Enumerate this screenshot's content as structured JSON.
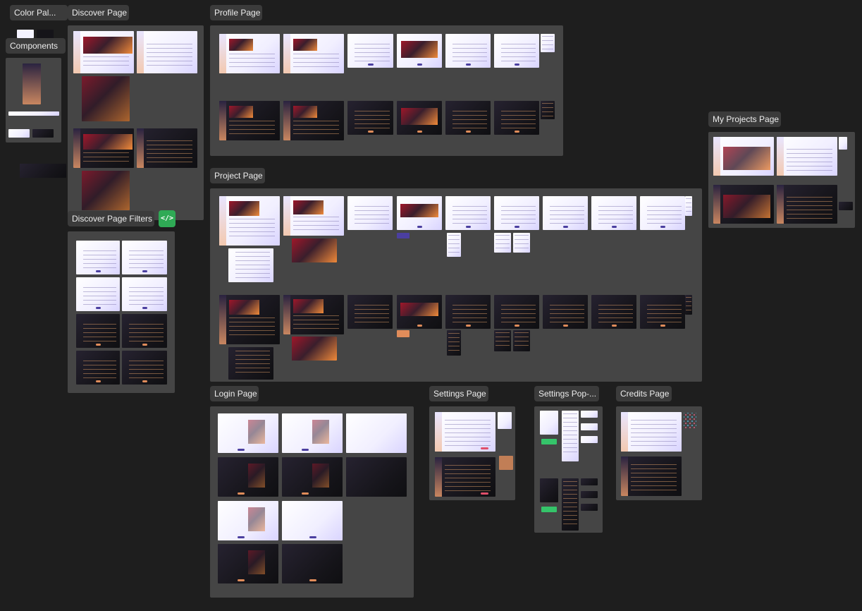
{
  "canvas": {
    "background": "#1e1e1e",
    "section_color": "#454545",
    "accent_light": "#4b3fa0",
    "accent_dark": "#e08c5a"
  },
  "sections": {
    "color_palette": "Color Pal...",
    "components": "Components",
    "discover_page": "Discover Page",
    "discover_page_filters": "Discover Page Filters",
    "profile_page": "Profile Page",
    "project_page": "Project Page",
    "my_projects_page": "My Projects Page",
    "login_page": "Login Page",
    "settings_page": "Settings Page",
    "settings_popups": "Settings Pop-...",
    "credits_page": "Credits Page"
  },
  "embed_button": {
    "icon": "code-icon",
    "glyph": "</>"
  }
}
